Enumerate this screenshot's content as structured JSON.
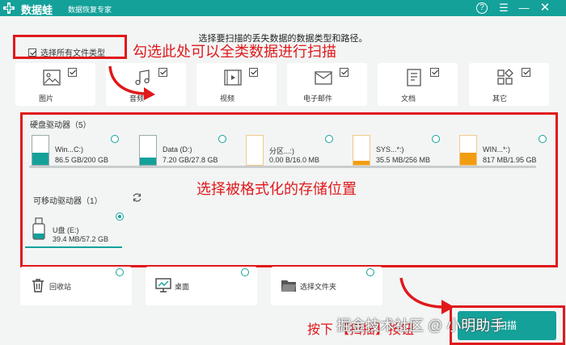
{
  "app": {
    "title": "数据蛙",
    "subtitle": "数据恢复专家"
  },
  "titlebar": {
    "help_icon": "?",
    "menu_icon": "☰",
    "min_icon": "—",
    "close_icon": "✕"
  },
  "instruction": "选择要扫描的丢失数据的数据类型和路径。",
  "select_all": {
    "label": "选择所有文件类型",
    "checked": true
  },
  "annotations": {
    "select_all": "勾选此处可以全类数据进行扫描",
    "drive": "选择被格式化的存储位置",
    "scan_prefix": "按下",
    "scan_suffix": "【扫描】按钮"
  },
  "file_types": [
    {
      "label": "图片",
      "icon": "image-icon",
      "checked": true
    },
    {
      "label": "音频",
      "icon": "music-icon",
      "checked": true
    },
    {
      "label": "视频",
      "icon": "video-icon",
      "checked": true
    },
    {
      "label": "电子邮件",
      "icon": "mail-icon",
      "checked": true
    },
    {
      "label": "文档",
      "icon": "document-icon",
      "checked": true
    },
    {
      "label": "其它",
      "icon": "other-icon",
      "checked": true
    }
  ],
  "hard_drives": {
    "title": "硬盘驱动器（5）",
    "items": [
      {
        "name": "Win...C:)",
        "size": "86.5 GB/200 GB",
        "fill_fraction": 0.43,
        "color": "#14a19a"
      },
      {
        "name": "Data (D:)",
        "size": "7.20 GB/27.8 GB",
        "fill_fraction": 0.26,
        "color": "#14a19a"
      },
      {
        "name": "分区...:)",
        "size": "0.00 B/16.0 MB",
        "fill_fraction": 0.0,
        "color": "#f39c12"
      },
      {
        "name": "SYS...*:)",
        "size": "35.5 MB/256 MB",
        "fill_fraction": 0.14,
        "color": "#f39c12"
      },
      {
        "name": "WIN...*:)",
        "size": "817 MB/1.95 GB",
        "fill_fraction": 0.41,
        "color": "#f39c12"
      }
    ]
  },
  "removable_drives": {
    "title": "可移动驱动器（1）",
    "refresh_icon": "refresh-icon",
    "items": [
      {
        "name": "U盘 (E:)",
        "size": "39.4 MB/57.2 GB",
        "selected": true
      }
    ]
  },
  "locations": [
    {
      "label": "回收站",
      "icon": "trash-icon"
    },
    {
      "label": "桌面",
      "icon": "desktop-icon"
    },
    {
      "label": "选择文件夹",
      "icon": "folder-icon"
    }
  ],
  "scan_button": {
    "label": "扫描"
  },
  "watermark": "掘金技术社区 @ 小明助手",
  "colors": {
    "brand": "#14a19a",
    "annotation": "#e0191b",
    "warn": "#f39c12"
  }
}
